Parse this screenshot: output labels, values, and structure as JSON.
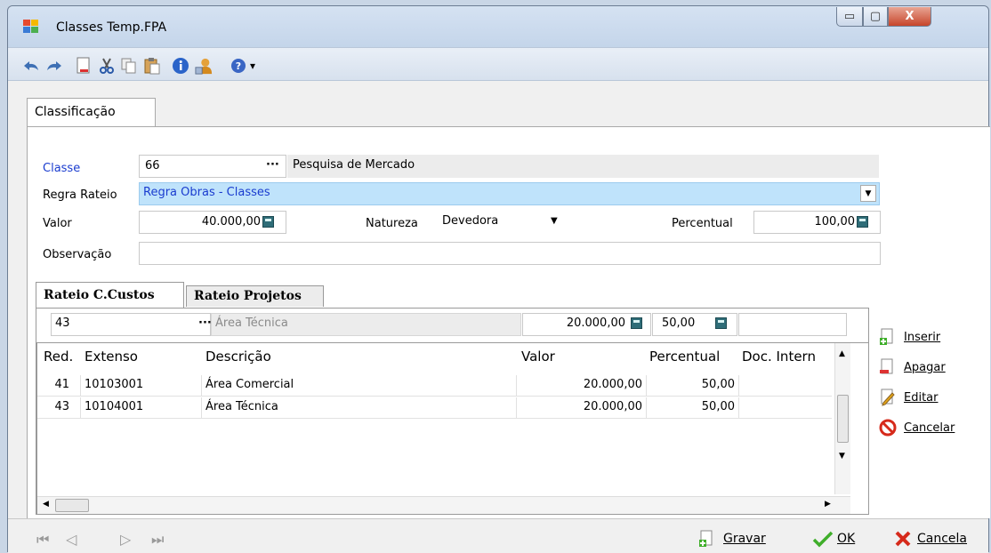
{
  "window": {
    "title": "Classes Temp.FPA",
    "min_glyph": "▭",
    "max_glyph": "▢",
    "close_glyph": "X"
  },
  "toolbar": {
    "icons": [
      "undo-icon",
      "redo-icon",
      "new-document-icon",
      "cut-icon",
      "copy-icon",
      "paste-icon",
      "info-icon",
      "user-icon",
      "help-icon",
      "dropdown-arrow-icon"
    ],
    "dropdown_glyph": "▾"
  },
  "main_tab": {
    "label": "Classificação"
  },
  "form": {
    "classe_label": "Classe",
    "classe_code": "66",
    "classe_desc": "Pesquisa de Mercado",
    "regra_label": "Regra Rateio",
    "regra_value": "Regra Obras - Classes",
    "valor_label": "Valor",
    "valor_value": "40.000,00",
    "natureza_label": "Natureza",
    "natureza_value": "Devedora",
    "percentual_label": "Percentual",
    "percentual_value": "100,00",
    "observacao_label": "Observação",
    "observacao_value": "",
    "dots": "···",
    "dropdown_glyph": "▼"
  },
  "sub_tabs": [
    {
      "label": "Rateio C.Custos",
      "active": true
    },
    {
      "label": "Rateio Projetos",
      "active": false
    }
  ],
  "entry": {
    "code": "43",
    "desc": "Área Técnica",
    "valor": "20.000,00",
    "percentual": "50,00",
    "doc": ""
  },
  "grid": {
    "headers": [
      "Red.",
      "Extenso",
      "Descrição",
      "Valor",
      "Percentual",
      "Doc. Intern"
    ],
    "rows": [
      [
        "41",
        "10103001",
        "Área Comercial",
        "20.000,00",
        "50,00",
        ""
      ],
      [
        "43",
        "10104001",
        "Área Técnica",
        "20.000,00",
        "50,00",
        ""
      ]
    ]
  },
  "side_buttons": {
    "inserir": "Inserir",
    "apagar": "Apagar",
    "editar": "Editar",
    "cancelar": "Cancelar"
  },
  "bottom": {
    "gravar": "Gravar",
    "ok": "OK",
    "cancela": "Cancela"
  },
  "colors": {
    "accent_label": "#1a3ccf",
    "selection": "#bfe3fb",
    "ok_check": "#3fae2a",
    "cancel_x": "#d62a1b"
  }
}
